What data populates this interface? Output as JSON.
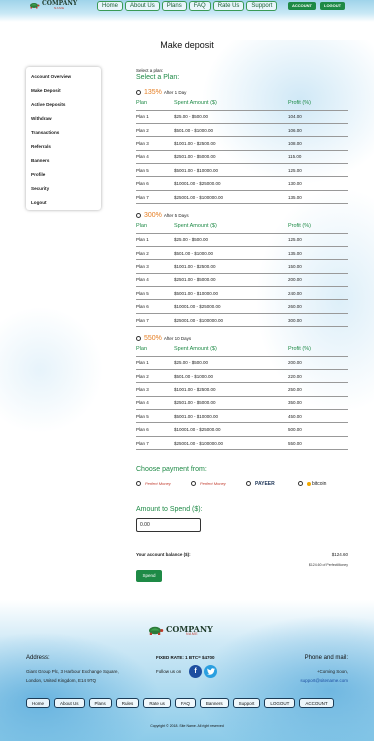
{
  "header": {
    "logo_text": "COMPANY",
    "logo_sub": "NAME",
    "nav": [
      "Home",
      "About Us",
      "Plans",
      "FAQ",
      "Rate Us",
      "Support"
    ],
    "account_button": "ACCOUNT",
    "logout_button": "LOGOUT"
  },
  "page_title": "Make deposit",
  "sidebar": {
    "items": [
      "Account Overview",
      "Make Deposit",
      "Active Deposits",
      "Withdraw",
      "Transactions",
      "Referrals",
      "Banners",
      "Profile",
      "Security",
      "Logout"
    ]
  },
  "form": {
    "select_label": "Select a plan:",
    "select_heading": "Select a Plan:",
    "columns": [
      "Plan",
      "Spent Amount ($)",
      "Profit (%)"
    ],
    "plans": [
      {
        "percent": "135%",
        "duration": "After 1 Day",
        "rows": [
          [
            "Plan 1",
            "$25.00 - $500.00",
            "104.00"
          ],
          [
            "Plan 2",
            "$501.00 - $1000.00",
            "106.00"
          ],
          [
            "Plan 3",
            "$1001.00 - $2500.00",
            "108.00"
          ],
          [
            "Plan 4",
            "$2501.00 - $5000.00",
            "115.00"
          ],
          [
            "Plan 5",
            "$5001.00 - $10000.00",
            "125.00"
          ],
          [
            "Plan 6",
            "$10001.00 - $25000.00",
            "130.00"
          ],
          [
            "Plan 7",
            "$25001.00 - $100000.00",
            "135.00"
          ]
        ]
      },
      {
        "percent": "300%",
        "duration": "After 5 Days",
        "rows": [
          [
            "Plan 1",
            "$25.00 - $500.00",
            "125.00"
          ],
          [
            "Plan 2",
            "$501.00 - $1000.00",
            "135.00"
          ],
          [
            "Plan 3",
            "$1001.00 - $2500.00",
            "150.00"
          ],
          [
            "Plan 4",
            "$2501.00 - $5000.00",
            "200.00"
          ],
          [
            "Plan 5",
            "$5001.00 - $10000.00",
            "240.00"
          ],
          [
            "Plan 6",
            "$10001.00 - $25000.00",
            "260.00"
          ],
          [
            "Plan 7",
            "$25001.00 - $100000.00",
            "300.00"
          ]
        ]
      },
      {
        "percent": "550%",
        "duration": "After 10 Days",
        "rows": [
          [
            "Plan 1",
            "$25.00 - $500.00",
            "200.00"
          ],
          [
            "Plan 2",
            "$501.00 - $1000.00",
            "220.00"
          ],
          [
            "Plan 3",
            "$1001.00 - $2500.00",
            "250.00"
          ],
          [
            "Plan 4",
            "$2501.00 - $5000.00",
            "350.00"
          ],
          [
            "Plan 5",
            "$5001.00 - $10000.00",
            "450.00"
          ],
          [
            "Plan 6",
            "$10001.00 - $25000.00",
            "500.00"
          ],
          [
            "Plan 7",
            "$25001.00 - $100000.00",
            "550.00"
          ]
        ]
      }
    ],
    "payment_heading": "Choose payment from:",
    "payment_options": [
      "Perfect Money",
      "Perfect Money",
      "PAYEER",
      "bitcoin"
    ],
    "amount_heading": "Amount to Spend ($):",
    "amount_value": "0.00",
    "balance_label": "Your account balance ($):",
    "balance_value": "$124.60",
    "balance_sub": "$124.60 of PerfectMoney",
    "spend_button": "Spend"
  },
  "footer": {
    "logo_text": "COMPANY",
    "logo_sub": "NAME",
    "address_heading": "Address:",
    "address": "Giant Group Plc, 3 Harbour Exchange Square, London, United Kingdom, E14 9TQ",
    "fixed_rate": "FIXED RATE: 1 BTC= $4700",
    "follow": "Follow us on",
    "phone_heading": "Phone and mail:",
    "phone": "+Coming Soon,",
    "mail": "support@sitename.com",
    "nav": [
      "Home",
      "About Us",
      "Plans",
      "Rules",
      "Rate us",
      "FAQ",
      "Banners",
      "Support",
      "LOGOUT",
      "ACCOUNT"
    ],
    "copyright": "Copyright © 2018. Site Name. All right reserved"
  }
}
